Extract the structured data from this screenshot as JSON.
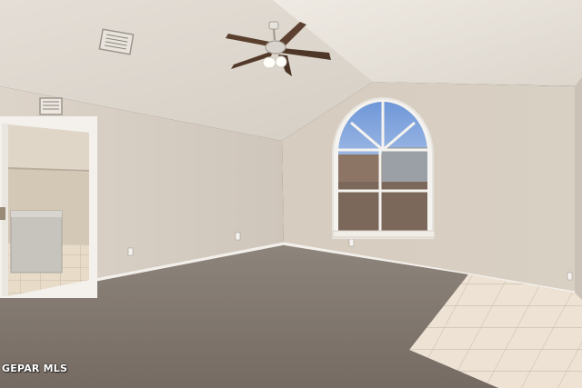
{
  "watermark": {
    "text": "GEPAR MLS"
  }
}
